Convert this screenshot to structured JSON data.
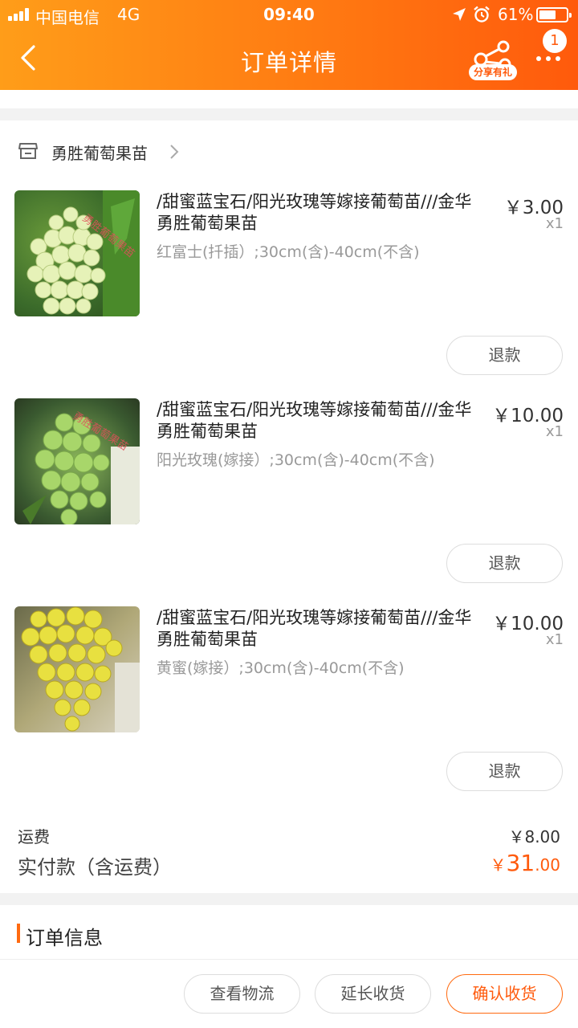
{
  "status_bar": {
    "carrier": "中国电信",
    "network": "4G",
    "time": "09:40",
    "battery_percent": "61%",
    "battery_level": 0.61
  },
  "header": {
    "title": "订单详情",
    "share_label": "分享有礼",
    "notification_count": "1",
    "icons": [
      "back-arrow-icon",
      "share-icon",
      "more-icon"
    ]
  },
  "store": {
    "name": "勇胜葡萄果苗",
    "icon": "store-icon"
  },
  "items": [
    {
      "title": "/甜蜜蓝宝石/阳光玫瑰等嫁接葡萄苗///金华勇胜葡萄果苗",
      "spec": "红富士(扦插）;30cm(含)-40cm(不含)",
      "price": "￥3.00",
      "qty": "x1",
      "refund_label": "退款",
      "image_watermark": "勇胜葡萄果苗"
    },
    {
      "title": "/甜蜜蓝宝石/阳光玫瑰等嫁接葡萄苗///金华勇胜葡萄果苗",
      "spec": "阳光玫瑰(嫁接）;30cm(含)-40cm(不含)",
      "price": "￥10.00",
      "qty": "x1",
      "refund_label": "退款",
      "image_watermark": "勇胜葡萄果苗"
    },
    {
      "title": "/甜蜜蓝宝石/阳光玫瑰等嫁接葡萄苗///金华勇胜葡萄果苗",
      "spec": "黄蜜(嫁接）;30cm(含)-40cm(不含)",
      "price": "￥10.00",
      "qty": "x1",
      "refund_label": "退款"
    }
  ],
  "summary": {
    "shipping_label": "运费",
    "shipping_value": "￥8.00",
    "paid_label": "实付款（含运费）",
    "paid_currency": "￥",
    "paid_integer": "31",
    "paid_decimal": ".00"
  },
  "order_info": {
    "title": "订单信息"
  },
  "actions": {
    "logistics": "查看物流",
    "extend": "延长收货",
    "confirm": "确认收货"
  },
  "colors": {
    "accent": "#ff6a10",
    "header_start": "#ff9d19",
    "header_end": "#ff5a0c"
  }
}
